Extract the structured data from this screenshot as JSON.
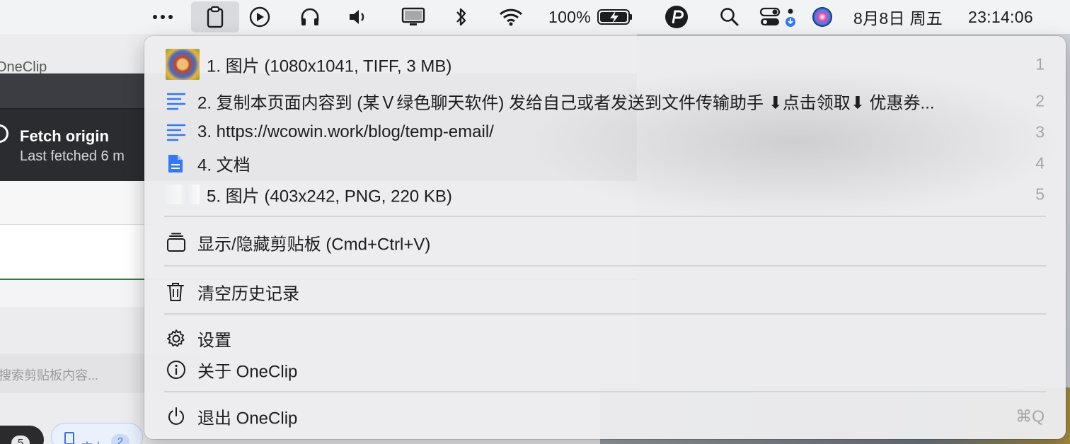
{
  "menubar": {
    "battery_percent": "100%",
    "date": "8月8日 周五",
    "time": "23:14:06",
    "icons": [
      "more-icon",
      "clipboard-icon",
      "play-icon",
      "headphones-icon",
      "volume-icon",
      "display-icon",
      "bluetooth-icon",
      "wifi-icon",
      "battery-icon",
      "pp-icon",
      "search-icon",
      "control-center-icon",
      "siri-icon"
    ]
  },
  "background_app": {
    "title": "OneClip",
    "fetch_title": "Fetch origin",
    "fetch_subtitle": "Last fetched 6 m",
    "search_placeholder": "搜索剪贴板内容...",
    "count_badge": "5",
    "type_tab": {
      "label": "文本",
      "count": "2"
    }
  },
  "menu": {
    "history": [
      {
        "label": "1. 图片 (1080x1041, TIFF, 3 MB)",
        "shortcut": "1",
        "kind": "image"
      },
      {
        "label": "2. 复制本页面内容到 (某Ｖ绿色聊天软件) 发给自己或者发送到文件传输助手 ⬇点击领取⬇ 优惠券...",
        "shortcut": "2",
        "kind": "text"
      },
      {
        "label": "3. https://wcowin.work/blog/temp-email/",
        "shortcut": "3",
        "kind": "text"
      },
      {
        "label": "4. 文档",
        "shortcut": "4",
        "kind": "document"
      },
      {
        "label": "5. 图片 (403x242, PNG, 220 KB)",
        "shortcut": "5",
        "kind": "image"
      }
    ],
    "toggle_label": "显示/隐藏剪贴板 (Cmd+Ctrl+V)",
    "clear_label": "清空历史记录",
    "settings_label": "设置",
    "about_label": "关于 OneClip",
    "quit_label": "退出 OneClip",
    "quit_shortcut": "⌘Q"
  },
  "colors": {
    "menu_bg": "#ececee",
    "accent_blue": "#3478f6",
    "shortcut_gray": "#a5a5aa"
  }
}
